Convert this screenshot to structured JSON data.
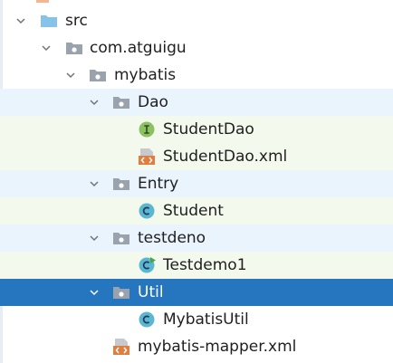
{
  "tree": {
    "items": [
      {
        "label": "src"
      },
      {
        "label": "com.atguigu"
      },
      {
        "label": "mybatis"
      },
      {
        "label": "Dao"
      },
      {
        "label": "StudentDao"
      },
      {
        "label": "StudentDao.xml"
      },
      {
        "label": "Entry"
      },
      {
        "label": "Student"
      },
      {
        "label": "testdeno"
      },
      {
        "label": "Testdemo1"
      },
      {
        "label": "Util"
      },
      {
        "label": "MybatisUtil"
      },
      {
        "label": "mybatis-mapper.xml"
      }
    ],
    "selected": "Util"
  },
  "colors": {
    "selection": "#2675bf",
    "package_row_bg": "#eaf4fc",
    "file_row_bg": "#f3f9ec",
    "interface_icon": "#8cc162",
    "class_icon": "#5bb6d2",
    "xml_icon": "#e07d3f",
    "folder_blue": "#86c3ea",
    "package_folder": "#9aa3ad"
  }
}
